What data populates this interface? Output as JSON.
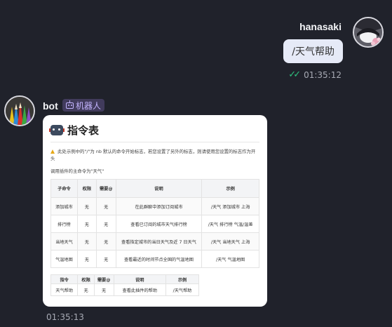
{
  "user_message": {
    "sender": "hanasaki",
    "text": "/天气帮助",
    "time": "01:35:12",
    "read_icon": "double-check-icon"
  },
  "bot_message": {
    "sender": "bot",
    "badge": "机器人",
    "badge_icon": "robot-badge-icon",
    "time": "01:35:13",
    "card": {
      "title": "指令表",
      "title_icon": "robot-head-icon",
      "note": "此处示例中的\"/\"为 nb 默认的命令开始标志，若您设置了另外的标志，则请使用您设置的标志作为开头",
      "note_icon": "warning-icon",
      "intro": "调用插件的主命令为\"天气\"",
      "table1": {
        "headers": [
          "子命令",
          "权限",
          "需要@",
          "说明",
          "示例"
        ],
        "rows": [
          [
            "添加城市",
            "无",
            "无",
            "在此群聊中添加订阅城市",
            "/天气 添加城市 上海"
          ],
          [
            "排行榜",
            "无",
            "无",
            "查看已订阅的城市天气排行榜",
            "/天气 排行榜 气温/温差"
          ],
          [
            "当地天气",
            "无",
            "无",
            "查看指定城市的当日天气及近 7 日天气",
            "/天气 当地天气 上海"
          ],
          [
            "气温地图",
            "无",
            "无",
            "查看最近的时间节点全国的气温地图",
            "/天气 气温地图"
          ]
        ]
      },
      "table2": {
        "headers": [
          "指令",
          "权限",
          "需要@",
          "说明",
          "示例"
        ],
        "rows": [
          [
            "天气帮助",
            "无",
            "无",
            "查看此插件的帮助",
            "/天气帮助"
          ]
        ]
      }
    }
  }
}
